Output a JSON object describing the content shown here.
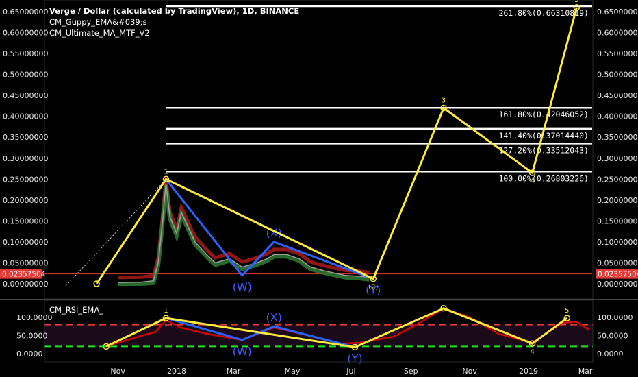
{
  "chart_title": "Verge / Dollar (calculated by TradingView), 1D, BINANCE",
  "indicators": [
    "CM_Guppy_EMA&#039;s",
    "CM_Ultimate_MA_MTF_V2"
  ],
  "rsi_title": "CM_RSI_EMA_",
  "current_price_label": "0.02357504",
  "colors": {
    "background": "#000000",
    "wave": "#ffeb3b",
    "corrective": "#2962ff",
    "fib": "#ffffff",
    "price_line": "#e53935",
    "rsi_upper": "#e53935",
    "rsi_lower": "#1de51d"
  },
  "chart_data": [
    {
      "type": "line",
      "title": "Verge / Dollar (calculated by TradingView), 1D, BINANCE",
      "x_tick_labels": [
        "Nov",
        "2018",
        "Mar",
        "May",
        "Jul",
        "Sep",
        "Nov",
        "2019",
        "Mar"
      ],
      "y_tick_labels": [
        "0.00000000",
        "0.05000000",
        "0.10000000",
        "0.15000000",
        "0.20000000",
        "0.25000000",
        "0.30000000",
        "0.35000000",
        "0.40000000",
        "0.45000000",
        "0.50000000",
        "0.55000000",
        "0.60000000",
        "0.65000000"
      ],
      "ylim": [
        -0.02,
        0.665
      ],
      "current_price": 0.02357504,
      "price_series": [
        {
          "x": "2017-11-01",
          "y": 0.003
        },
        {
          "x": "2017-11-25",
          "y": 0.004
        },
        {
          "x": "2017-12-08",
          "y": 0.007
        },
        {
          "x": "2017-12-13",
          "y": 0.05
        },
        {
          "x": "2017-12-17",
          "y": 0.14
        },
        {
          "x": "2017-12-21",
          "y": 0.24
        },
        {
          "x": "2017-12-25",
          "y": 0.16
        },
        {
          "x": "2018-01-01",
          "y": 0.12
        },
        {
          "x": "2018-01-06",
          "y": 0.17
        },
        {
          "x": "2018-01-12",
          "y": 0.14
        },
        {
          "x": "2018-01-20",
          "y": 0.1
        },
        {
          "x": "2018-02-01",
          "y": 0.07
        },
        {
          "x": "2018-02-10",
          "y": 0.05
        },
        {
          "x": "2018-02-25",
          "y": 0.06
        },
        {
          "x": "2018-03-10",
          "y": 0.04
        },
        {
          "x": "2018-03-25",
          "y": 0.05
        },
        {
          "x": "2018-04-05",
          "y": 0.06
        },
        {
          "x": "2018-04-12",
          "y": 0.07
        },
        {
          "x": "2018-04-25",
          "y": 0.07
        },
        {
          "x": "2018-05-08",
          "y": 0.06
        },
        {
          "x": "2018-05-20",
          "y": 0.04
        },
        {
          "x": "2018-06-05",
          "y": 0.03
        },
        {
          "x": "2018-06-25",
          "y": 0.02
        },
        {
          "x": "2018-07-10",
          "y": 0.018
        },
        {
          "x": "2018-07-20",
          "y": 0.015
        }
      ],
      "wave_path": [
        {
          "x": "2017-10-10",
          "y": 0.0,
          "label": ""
        },
        {
          "x": "2017-12-21",
          "y": 0.25,
          "label": "1"
        },
        {
          "x": "2018-07-24",
          "y": 0.012,
          "label": "(2)"
        },
        {
          "x": "2018-10-05",
          "y": 0.42,
          "label": "3"
        },
        {
          "x": "2019-01-05",
          "y": 0.265,
          "label": "4"
        },
        {
          "x": "2019-02-20",
          "y": 0.66,
          "label": "5"
        }
      ],
      "corrective_path": [
        {
          "x": "2017-12-21",
          "y": 0.25,
          "label": ""
        },
        {
          "x": "2018-03-10",
          "y": 0.02,
          "label": "(W)"
        },
        {
          "x": "2018-04-12",
          "y": 0.1,
          "label": "(X)"
        },
        {
          "x": "2018-07-24",
          "y": 0.012,
          "label": "(Y)"
        }
      ],
      "fib_levels": [
        {
          "label": "261.80%(0.66310819)",
          "value": 0.66310819
        },
        {
          "label": "161.80%(0.42046052)",
          "value": 0.42046052
        },
        {
          "label": "141.40%(0.37014440)",
          "value": 0.3701444
        },
        {
          "label": "127.20%(0.33512043)",
          "value": 0.33512043
        },
        {
          "label": "100.00%(0.26803226)",
          "value": 0.26803226
        }
      ]
    },
    {
      "type": "line",
      "title": "CM_RSI_EMA_",
      "x_tick_labels": [
        "Nov",
        "2018",
        "Mar",
        "May",
        "Jul",
        "Sep",
        "Nov",
        "2019",
        "Mar"
      ],
      "y_tick_labels": [
        "0.0000",
        "50.0000",
        "100.0000"
      ],
      "ylim": [
        -8,
        128
      ],
      "upper_band": 80,
      "lower_band": 20,
      "rsi_series": [
        {
          "x": "2017-10-20",
          "y": 20
        },
        {
          "x": "2017-11-20",
          "y": 45
        },
        {
          "x": "2017-12-10",
          "y": 60
        },
        {
          "x": "2017-12-21",
          "y": 92
        },
        {
          "x": "2018-01-05",
          "y": 72
        },
        {
          "x": "2018-02-01",
          "y": 55
        },
        {
          "x": "2018-03-10",
          "y": 38
        },
        {
          "x": "2018-04-12",
          "y": 72
        },
        {
          "x": "2018-05-15",
          "y": 52
        },
        {
          "x": "2018-06-20",
          "y": 28
        },
        {
          "x": "2018-07-10",
          "y": 30
        },
        {
          "x": "2018-08-15",
          "y": 48
        },
        {
          "x": "2018-09-10",
          "y": 85
        },
        {
          "x": "2018-10-05",
          "y": 135
        },
        {
          "x": "2018-11-01",
          "y": 100
        },
        {
          "x": "2018-12-01",
          "y": 55
        },
        {
          "x": "2019-01-05",
          "y": 30
        },
        {
          "x": "2019-02-05",
          "y": 85
        },
        {
          "x": "2019-02-20",
          "y": 88
        },
        {
          "x": "2019-03-05",
          "y": 65
        }
      ],
      "rsi_wave_path": [
        {
          "x": "2017-10-20",
          "y": 20,
          "label": ""
        },
        {
          "x": "2017-12-21",
          "y": 98,
          "label": "1"
        },
        {
          "x": "2018-07-05",
          "y": 18,
          "label": "(Y)"
        },
        {
          "x": "2018-10-05",
          "y": 140,
          "label": ""
        },
        {
          "x": "2019-01-05",
          "y": 28,
          "label": "4"
        },
        {
          "x": "2019-02-10",
          "y": 98,
          "label": "5"
        }
      ],
      "rsi_corrective_path": [
        {
          "x": "2017-12-21",
          "y": 98,
          "label": ""
        },
        {
          "x": "2018-03-10",
          "y": 38,
          "label": "(W)"
        },
        {
          "x": "2018-04-12",
          "y": 75,
          "label": "(X)"
        },
        {
          "x": "2018-07-05",
          "y": 18,
          "label": ""
        }
      ]
    }
  ]
}
